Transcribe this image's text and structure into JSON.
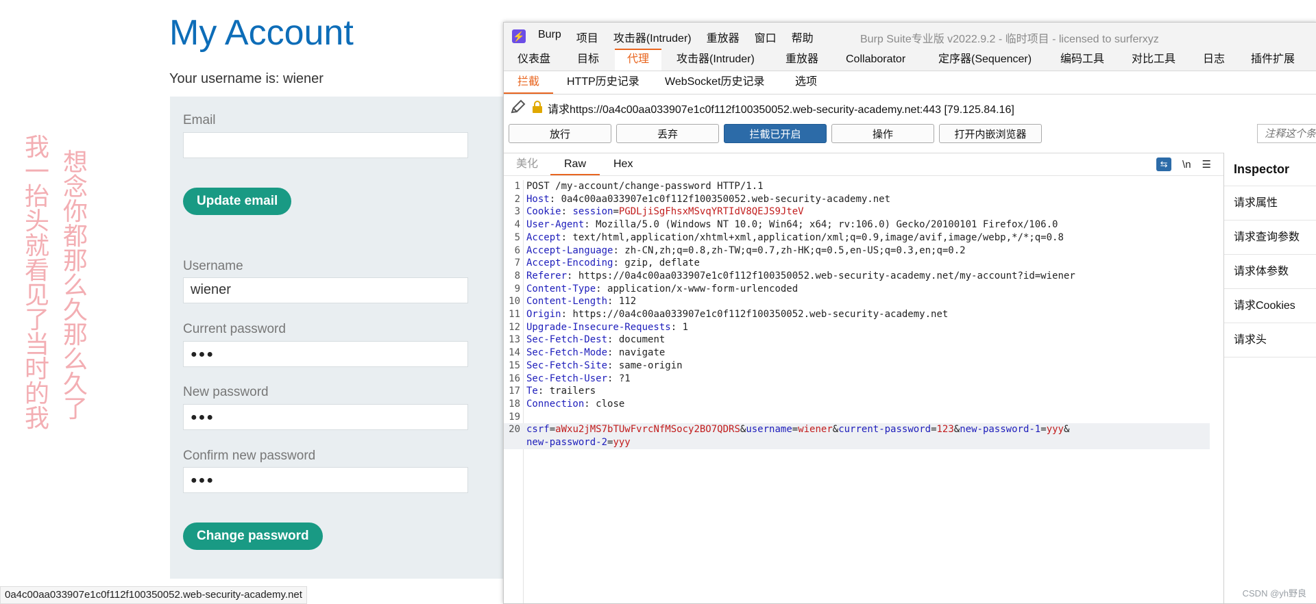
{
  "web": {
    "page_title": "My Account",
    "username_line": "Your username is: wiener",
    "email_label": "Email",
    "email_value": "",
    "update_email_button": "Update email",
    "username_label": "Username",
    "username_value": "wiener",
    "current_password_label": "Current password",
    "current_password_value": "●●●",
    "new_password_label": "New password",
    "new_password_value": "●●●",
    "confirm_password_label": "Confirm new password",
    "confirm_password_value": "●●●",
    "change_password_button": "Change password",
    "status_url": "0a4c00aa033907e1c0f112f100350052.web-security-academy.net",
    "overlay_text_1": "我一抬头就看见了当时的我",
    "overlay_text_2": "想念你都那么久那么久了"
  },
  "burp": {
    "menu": [
      "Burp",
      "项目",
      "攻击器(Intruder)",
      "重放器",
      "窗口",
      "帮助"
    ],
    "window_title": "Burp Suite专业版  v2022.9.2 - 临时项目 - licensed to surferxyz",
    "main_tabs": [
      "仪表盘",
      "目标",
      "代理",
      "攻击器(Intruder)",
      "重放器",
      "Collaborator",
      "定序器(Sequencer)",
      "编码工具",
      "对比工具",
      "日志",
      "插件扩展"
    ],
    "active_main_tab": "代理",
    "proxy_tabs": [
      "拦截",
      "HTTP历史记录",
      "WebSocket历史记录",
      "选项"
    ],
    "request_line": "请求https://0a4c00aa033907e1c0f112f100350052.web-security-academy.net:443  [79.125.84.16]",
    "buttons": {
      "forward": "放行",
      "drop": "丢弃",
      "intercept": "拦截已开启",
      "action": "操作",
      "open_browser": "打开内嵌浏览器"
    },
    "annotation_placeholder": "注释这个条",
    "editor_tabs": [
      "美化",
      "Raw",
      "Hex"
    ],
    "newline_toggle": "\\n",
    "menu_icon": "☰",
    "request_lines": [
      {
        "n": "1",
        "key": "",
        "sep": "",
        "value": "POST /my-account/change-password HTTP/1.1"
      },
      {
        "n": "2",
        "key": "Host",
        "sep": ": ",
        "value": "0a4c00aa033907e1c0f112f100350052.web-security-academy.net"
      },
      {
        "n": "3",
        "key": "Cookie",
        "sep": ": ",
        "value": "session=PGDLjiSgFhsxMSvqYRTIdV8QEJS9JteV"
      },
      {
        "n": "4",
        "key": "User-Agent",
        "sep": ": ",
        "value": "Mozilla/5.0 (Windows NT 10.0; Win64; x64; rv:106.0) Gecko/20100101 Firefox/106.0"
      },
      {
        "n": "5",
        "key": "Accept",
        "sep": ": ",
        "value": "text/html,application/xhtml+xml,application/xml;q=0.9,image/avif,image/webp,*/*;q=0.8"
      },
      {
        "n": "6",
        "key": "Accept-Language",
        "sep": ": ",
        "value": "zh-CN,zh;q=0.8,zh-TW;q=0.7,zh-HK;q=0.5,en-US;q=0.3,en;q=0.2"
      },
      {
        "n": "7",
        "key": "Accept-Encoding",
        "sep": ": ",
        "value": "gzip, deflate"
      },
      {
        "n": "8",
        "key": "Referer",
        "sep": ": ",
        "value": "https://0a4c00aa033907e1c0f112f100350052.web-security-academy.net/my-account?id=wiener"
      },
      {
        "n": "9",
        "key": "Content-Type",
        "sep": ": ",
        "value": "application/x-www-form-urlencoded"
      },
      {
        "n": "10",
        "key": "Content-Length",
        "sep": ": ",
        "value": "112"
      },
      {
        "n": "11",
        "key": "Origin",
        "sep": ": ",
        "value": "https://0a4c00aa033907e1c0f112f100350052.web-security-academy.net"
      },
      {
        "n": "12",
        "key": "Upgrade-Insecure-Requests",
        "sep": ": ",
        "value": "1"
      },
      {
        "n": "13",
        "key": "Sec-Fetch-Dest",
        "sep": ": ",
        "value": "document"
      },
      {
        "n": "14",
        "key": "Sec-Fetch-Mode",
        "sep": ": ",
        "value": "navigate"
      },
      {
        "n": "15",
        "key": "Sec-Fetch-Site",
        "sep": ": ",
        "value": "same-origin"
      },
      {
        "n": "16",
        "key": "Sec-Fetch-User",
        "sep": ": ",
        "value": "?1"
      },
      {
        "n": "17",
        "key": "Te",
        "sep": ": ",
        "value": "trailers"
      },
      {
        "n": "18",
        "key": "Connection",
        "sep": ": ",
        "value": "close"
      },
      {
        "n": "19",
        "key": "",
        "sep": "",
        "value": ""
      }
    ],
    "body_line_number": "20",
    "body_params": [
      {
        "key": "csrf",
        "value": "aWxu2jMS7bTUwFvrcNfMSocy2BO7QDRS"
      },
      {
        "key": "username",
        "value": "wiener"
      },
      {
        "key": "current-password",
        "value": "123"
      },
      {
        "key": "new-password-1",
        "value": "yyy"
      },
      {
        "key": "new-password-2",
        "value": "yyy"
      }
    ],
    "inspector": {
      "title": "Inspector",
      "items": [
        "请求属性",
        "请求查询参数",
        "请求体参数",
        "请求Cookies",
        "请求头"
      ]
    },
    "watermark": "CSDN @yh野良"
  },
  "colors": {
    "link_blue": "#0d6db8",
    "green_button": "#199a84",
    "burp_orange": "#e8651f",
    "burp_button_blue": "#2c6ba8",
    "header_key_blue": "#1d1dbb",
    "value_red": "#c21d1d"
  }
}
